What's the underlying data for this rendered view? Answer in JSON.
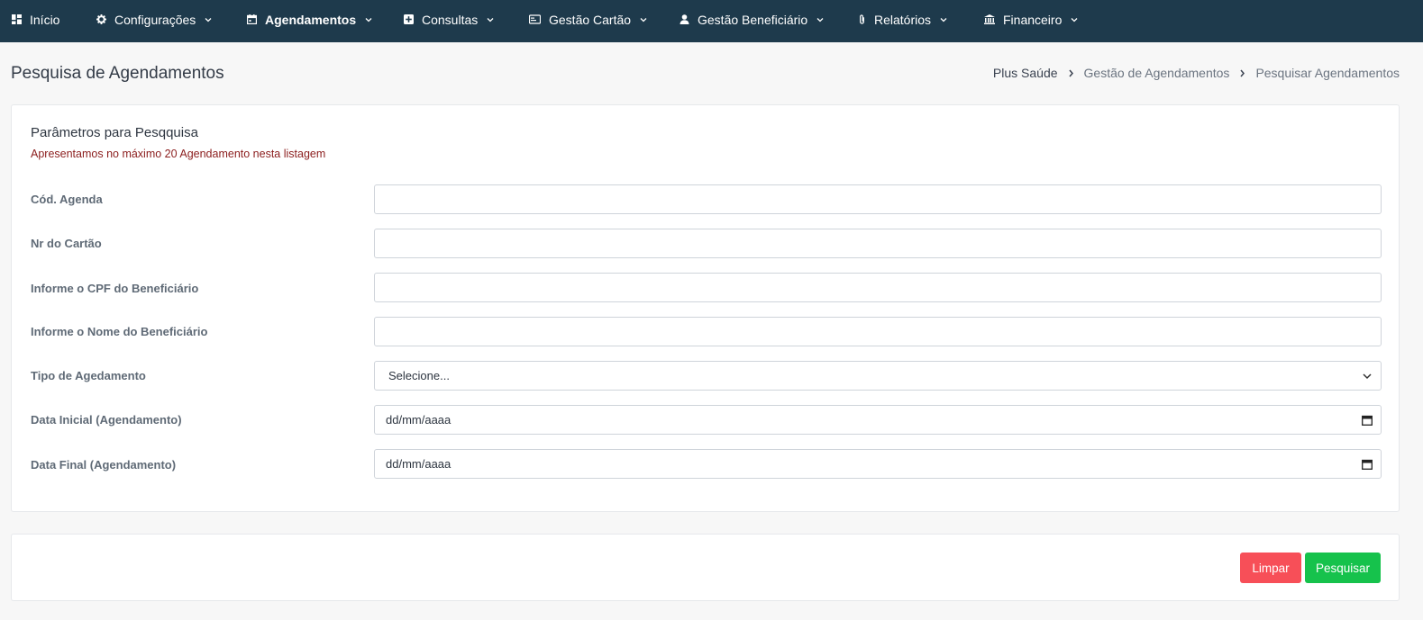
{
  "nav": {
    "items": [
      {
        "label": "Início",
        "icon": "grid-icon",
        "active": false
      },
      {
        "label": "Configurações",
        "icon": "gear-icon",
        "active": false
      },
      {
        "label": "Agendamentos",
        "icon": "calendar-icon",
        "active": true
      },
      {
        "label": "Consultas",
        "icon": "plus-square-icon",
        "active": false
      },
      {
        "label": "Gestão Cartão",
        "icon": "card-icon",
        "active": false
      },
      {
        "label": "Gestão Beneficiário",
        "icon": "user-icon",
        "active": false
      },
      {
        "label": "Relatórios",
        "icon": "paperclip-icon",
        "active": false
      },
      {
        "label": "Financeiro",
        "icon": "bank-icon",
        "active": false
      }
    ]
  },
  "header": {
    "title": "Pesquisa de Agendamentos",
    "breadcrumb": [
      "Plus Saúde",
      "Gestão de Agendamentos",
      "Pesquisar Agendamentos"
    ]
  },
  "params": {
    "title": "Parâmetros para Pesqquisa",
    "subtitle": "Apresentamos no máximo 20 Agendamento nesta listagem",
    "fields": [
      {
        "label": "Cód. Agenda",
        "value": "",
        "type": "text"
      },
      {
        "label": "Nr do Cartão",
        "value": "",
        "type": "text"
      },
      {
        "label": "Informe o CPF do Beneficiário",
        "value": "",
        "type": "text"
      },
      {
        "label": "Informe o Nome do Beneficiário",
        "value": "",
        "type": "text"
      },
      {
        "label": "Tipo de Agedamento",
        "value": "Selecione...",
        "type": "select"
      },
      {
        "label": "Data Inicial (Agendamento)",
        "value": "dd/mm/aaaa",
        "type": "date"
      },
      {
        "label": "Data Final (Agendamento)",
        "value": "dd/mm/aaaa",
        "type": "date"
      }
    ]
  },
  "actions": {
    "clear_label": "Limpar",
    "search_label": "Pesquisar"
  },
  "colors": {
    "nav_bg": "#1e3a4c",
    "subtitle_red": "#8b1d1d",
    "clear_btn": "#f74f58",
    "search_btn": "#16c24c"
  }
}
